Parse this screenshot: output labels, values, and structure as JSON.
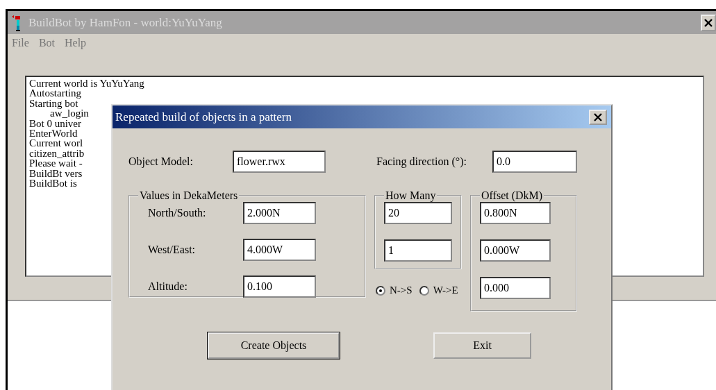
{
  "window": {
    "title": "BuildBot by HamFon - world:YuYuYang"
  },
  "menu": [
    {
      "label": "File"
    },
    {
      "label": "Bot"
    },
    {
      "label": "Help"
    }
  ],
  "log": [
    {
      "text": "Current world is YuYuYang",
      "indent": false
    },
    {
      "text": "Autostarting",
      "indent": false
    },
    {
      "text": "Starting bot",
      "indent": false
    },
    {
      "text": "aw_login",
      "indent": true
    },
    {
      "text": "Bot 0 univer",
      "indent": false
    },
    {
      "text": "EnterWorld",
      "indent": false
    },
    {
      "text": "Current worl",
      "indent": false
    },
    {
      "text": "citizen_attrib",
      "indent": false
    },
    {
      "text": "Please wait -",
      "indent": false
    },
    {
      "text": "BuildBt vers",
      "indent": false
    },
    {
      "text": "BuildBot is",
      "indent": false
    }
  ],
  "dialog": {
    "title": "Repeated build of objects in a pattern",
    "object_model": {
      "label": "Object Model:",
      "value": "flower.rwx"
    },
    "facing": {
      "label": "Facing direction (°):",
      "value": "0.0"
    },
    "values_group": {
      "title": "Values in DekaMeters",
      "rows": [
        {
          "label": "North/South:",
          "value": "2.000N"
        },
        {
          "label": "West/East:",
          "value": "4.000W"
        },
        {
          "label": "Altitude:",
          "value": "0.100"
        }
      ]
    },
    "how_many": {
      "title": "How Many",
      "values": [
        "20",
        "1"
      ]
    },
    "direction": [
      {
        "label": "N->S",
        "selected": true
      },
      {
        "label": "W->E",
        "selected": false
      }
    ],
    "offset": {
      "title": "Offset (DkM)",
      "values": [
        "0.800N",
        "0.000W",
        "0.000"
      ]
    },
    "buttons": [
      {
        "label": "Create Objects",
        "default": true
      },
      {
        "label": "Exit",
        "default": false
      }
    ]
  }
}
